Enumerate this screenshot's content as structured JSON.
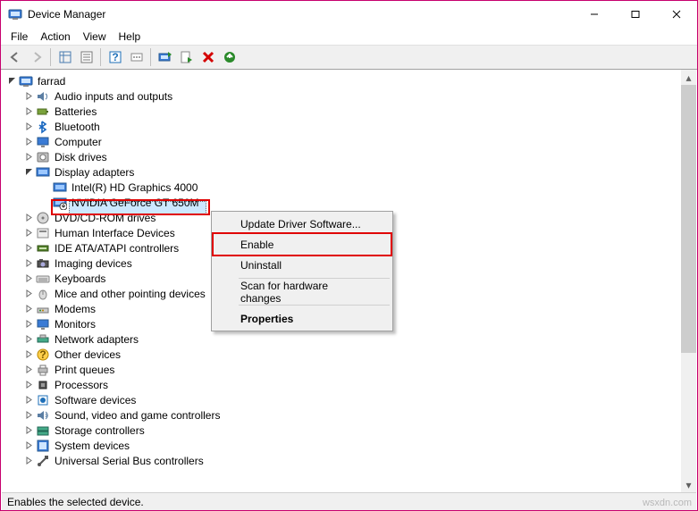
{
  "window": {
    "title": "Device Manager"
  },
  "menu": {
    "file": "File",
    "action": "Action",
    "view": "View",
    "help": "Help"
  },
  "root": {
    "label": "farrad"
  },
  "categories": [
    {
      "label": "Audio inputs and outputs",
      "expanded": false,
      "icon": "audio"
    },
    {
      "label": "Batteries",
      "expanded": false,
      "icon": "battery"
    },
    {
      "label": "Bluetooth",
      "expanded": false,
      "icon": "bluetooth"
    },
    {
      "label": "Computer",
      "expanded": false,
      "icon": "computer"
    },
    {
      "label": "Disk drives",
      "expanded": false,
      "icon": "disk"
    },
    {
      "label": "Display adapters",
      "expanded": true,
      "icon": "display",
      "children": [
        {
          "label": "Intel(R) HD Graphics 4000",
          "icon": "display",
          "selected": false
        },
        {
          "label": "NVIDIA GeForce GT 650M",
          "icon": "display-disabled",
          "selected": true
        }
      ]
    },
    {
      "label": "DVD/CD-ROM drives",
      "expanded": false,
      "icon": "optical"
    },
    {
      "label": "Human Interface Devices",
      "expanded": false,
      "icon": "hid"
    },
    {
      "label": "IDE ATA/ATAPI controllers",
      "expanded": false,
      "icon": "ide"
    },
    {
      "label": "Imaging devices",
      "expanded": false,
      "icon": "imaging"
    },
    {
      "label": "Keyboards",
      "expanded": false,
      "icon": "keyboard"
    },
    {
      "label": "Mice and other pointing devices",
      "expanded": false,
      "icon": "mouse"
    },
    {
      "label": "Modems",
      "expanded": false,
      "icon": "modem"
    },
    {
      "label": "Monitors",
      "expanded": false,
      "icon": "monitor"
    },
    {
      "label": "Network adapters",
      "expanded": false,
      "icon": "network"
    },
    {
      "label": "Other devices",
      "expanded": false,
      "icon": "unknown"
    },
    {
      "label": "Print queues",
      "expanded": false,
      "icon": "printer"
    },
    {
      "label": "Processors",
      "expanded": false,
      "icon": "cpu"
    },
    {
      "label": "Software devices",
      "expanded": false,
      "icon": "software"
    },
    {
      "label": "Sound, video and game controllers",
      "expanded": false,
      "icon": "sound"
    },
    {
      "label": "Storage controllers",
      "expanded": false,
      "icon": "storage"
    },
    {
      "label": "System devices",
      "expanded": false,
      "icon": "system"
    },
    {
      "label": "Universal Serial Bus controllers",
      "expanded": false,
      "icon": "usb"
    }
  ],
  "context_menu": {
    "update": "Update Driver Software...",
    "enable": "Enable",
    "uninstall": "Uninstall",
    "scan": "Scan for hardware changes",
    "properties": "Properties"
  },
  "status": {
    "text": "Enables the selected device."
  },
  "watermark": "wsxdn.com"
}
